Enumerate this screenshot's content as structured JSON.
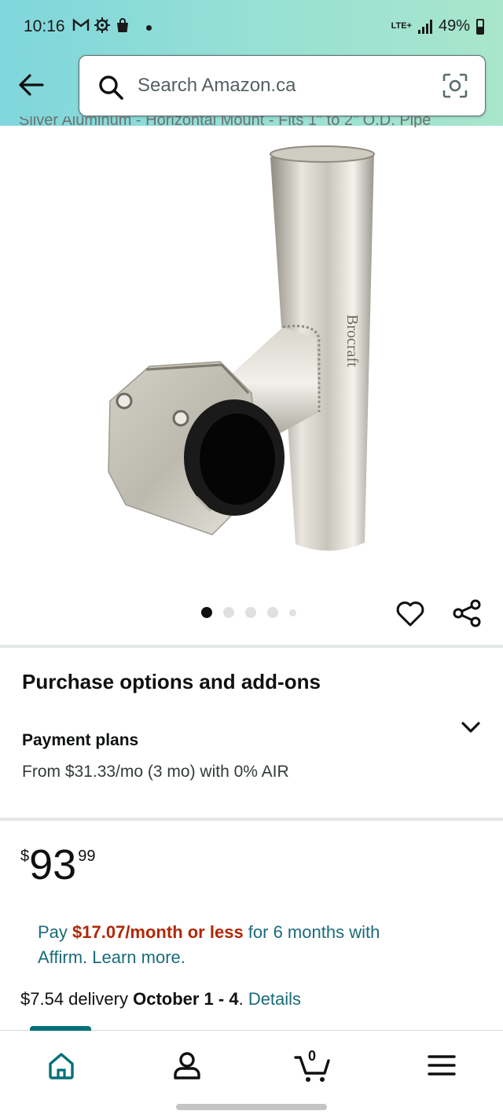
{
  "status_bar": {
    "time": "10:16",
    "icons": [
      "gmail-icon",
      "settings-icon",
      "shopping-bag-icon"
    ],
    "network": "LTE+",
    "battery": "49%"
  },
  "search": {
    "placeholder": "Search Amazon.ca"
  },
  "product": {
    "title_partial": "Silver Aluminum - Horizontal Mount - Fits 1\" to 2\" O.D. Pipe",
    "image_count": 5,
    "active_image": 1
  },
  "purchase_options": {
    "title": "Purchase options and add-ons",
    "payment_plans_label": "Payment plans",
    "payment_plans_detail": "From $31.33/mo (3 mo) with 0% AIR"
  },
  "price": {
    "symbol": "$",
    "whole": "93",
    "fraction": "99"
  },
  "affirm": {
    "prefix": "Pay ",
    "highlight": "$17.07/month or less",
    "middle": " for 6 months with",
    "link": "Affirm. Learn more."
  },
  "delivery": {
    "prefix": "$7.54 delivery ",
    "dates": "October 1 - 4",
    "separator": ". ",
    "details_link": "Details"
  },
  "bottom_nav": {
    "cart_count": "0",
    "items": [
      "home",
      "account",
      "cart",
      "menu"
    ]
  },
  "colors": {
    "header_start": "#7fd6dc",
    "header_end": "#a9e6cc",
    "link": "#1a6b7a",
    "price_highlight": "#b12704",
    "nav_indicator": "#00707a"
  }
}
